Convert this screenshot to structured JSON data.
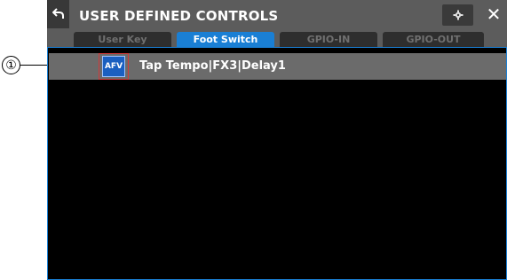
{
  "callout": {
    "number": "①"
  },
  "header": {
    "title": "USER DEFINED CONTROLS",
    "back_icon": "back-arrow-icon",
    "settings_icon": "gear-icon",
    "close_icon": "close-icon",
    "close_glyph": "✕"
  },
  "tabs": [
    {
      "label": "User Key",
      "active": false
    },
    {
      "label": "Foot Switch",
      "active": true
    },
    {
      "label": "GPIO-IN",
      "active": false
    },
    {
      "label": "GPIO-OUT",
      "active": false
    }
  ],
  "rows": [
    {
      "badge": "AFV",
      "label": "Tap Tempo|FX3|Delay1"
    }
  ],
  "colors": {
    "accent": "#1a7fd4",
    "badge": "#1a5fc0",
    "highlight": "#d23a3a",
    "background": "#000000",
    "toolbar": "#5c5c5c"
  }
}
